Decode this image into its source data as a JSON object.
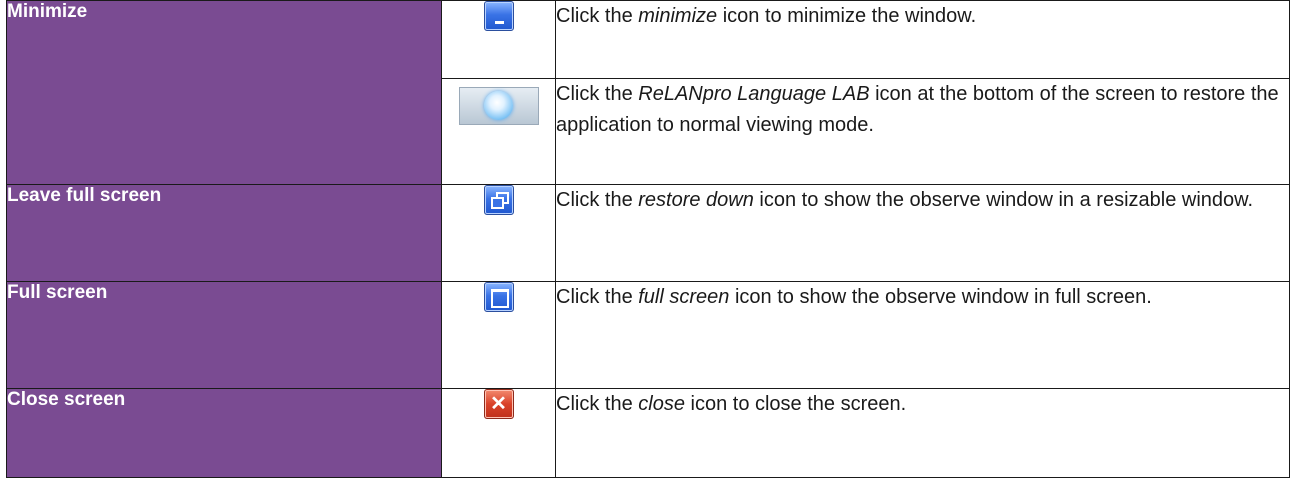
{
  "rows": [
    {
      "label": "Minimize",
      "items": [
        {
          "icon": "minimize-icon",
          "desc": {
            "before": "Click the ",
            "em": "minimize",
            "after": " icon to minimize the window."
          }
        },
        {
          "icon": "relanpro-taskbar-icon",
          "desc": {
            "before": "Click the ",
            "em": "ReLANpro Language LAB",
            "after": " icon at the bottom of the screen to restore the application to normal viewing mode."
          }
        }
      ]
    },
    {
      "label": "Leave full screen",
      "items": [
        {
          "icon": "restore-down-icon",
          "desc": {
            "before": "Click the ",
            "em": "restore down",
            "after": " icon to show the observe window in a resizable window."
          }
        }
      ]
    },
    {
      "label": "Full screen",
      "items": [
        {
          "icon": "full-screen-icon",
          "desc": {
            "before": "Click the ",
            "em": "full screen",
            "after": " icon to show the observe window in full screen."
          }
        }
      ]
    },
    {
      "label": "Close screen",
      "items": [
        {
          "icon": "close-icon",
          "desc": {
            "before": "Click the ",
            "em": "close",
            "after": " icon to close the screen."
          }
        }
      ]
    }
  ],
  "colors": {
    "label_background": "#7a4b92",
    "label_text": "#ffffff",
    "border": "#1a1a1a"
  }
}
